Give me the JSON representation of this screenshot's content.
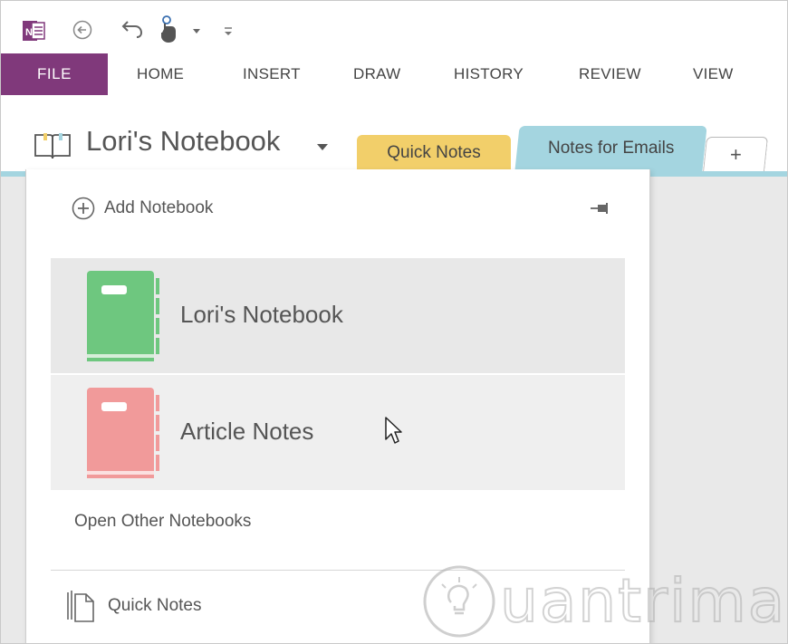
{
  "ribbon": {
    "file": "FILE",
    "tabs": [
      {
        "label": "HOME"
      },
      {
        "label": "INSERT"
      },
      {
        "label": "DRAW"
      },
      {
        "label": "HISTORY"
      },
      {
        "label": "REVIEW"
      },
      {
        "label": "VIEW"
      }
    ]
  },
  "notebook_header": {
    "title": "Lori's Notebook",
    "sections": [
      {
        "label": "Quick Notes",
        "color": "#f2cf6a"
      },
      {
        "label": "Notes for Emails",
        "color": "#a4d5e0"
      }
    ],
    "add_section_label": "+"
  },
  "dropdown": {
    "add_notebook_label": "Add Notebook",
    "notebooks": [
      {
        "name": "Lori's Notebook",
        "color": "#6ec77f"
      },
      {
        "name": "Article Notes",
        "color": "#f19a9a"
      }
    ],
    "open_other_label": "Open Other Notebooks",
    "quick_notes_label": "Quick Notes"
  },
  "colors": {
    "file_tab": "#80397b",
    "accent_tab": "#a4d5e0"
  },
  "watermark": {
    "text": "uantrimang"
  }
}
